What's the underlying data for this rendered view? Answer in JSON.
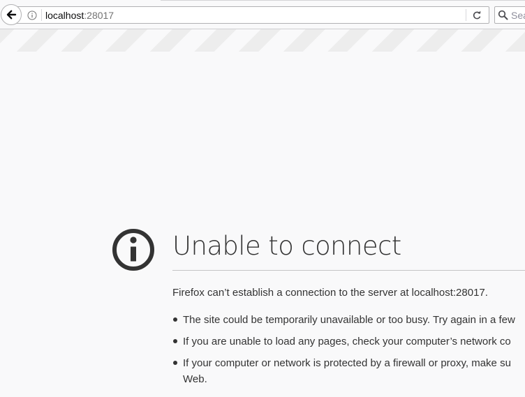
{
  "toolbar": {
    "back_icon": "arrow-left-icon",
    "info_icon": "info-circle-icon",
    "reload_icon": "reload-icon",
    "search_icon": "magnifier-icon",
    "url_host": "localhost",
    "url_port": ":28017",
    "search_placeholder": "Sea"
  },
  "error": {
    "icon": "info-circle-icon",
    "title": "Unable to connect",
    "description": "Firefox can’t establish a connection to the server at localhost:28017.",
    "bullets": [
      {
        "text": "The site could be temporarily unavailable or too busy. Try again in a few"
      },
      {
        "text": "If you are unable to load any pages, check your computer’s network co"
      },
      {
        "text": "If your computer or network is protected by a firewall or proxy, make su",
        "continuation": "Web."
      }
    ]
  },
  "colors": {
    "background": "#f9f9fa",
    "stripe": "#ededed",
    "icon": "#333333",
    "text": "#333333"
  }
}
